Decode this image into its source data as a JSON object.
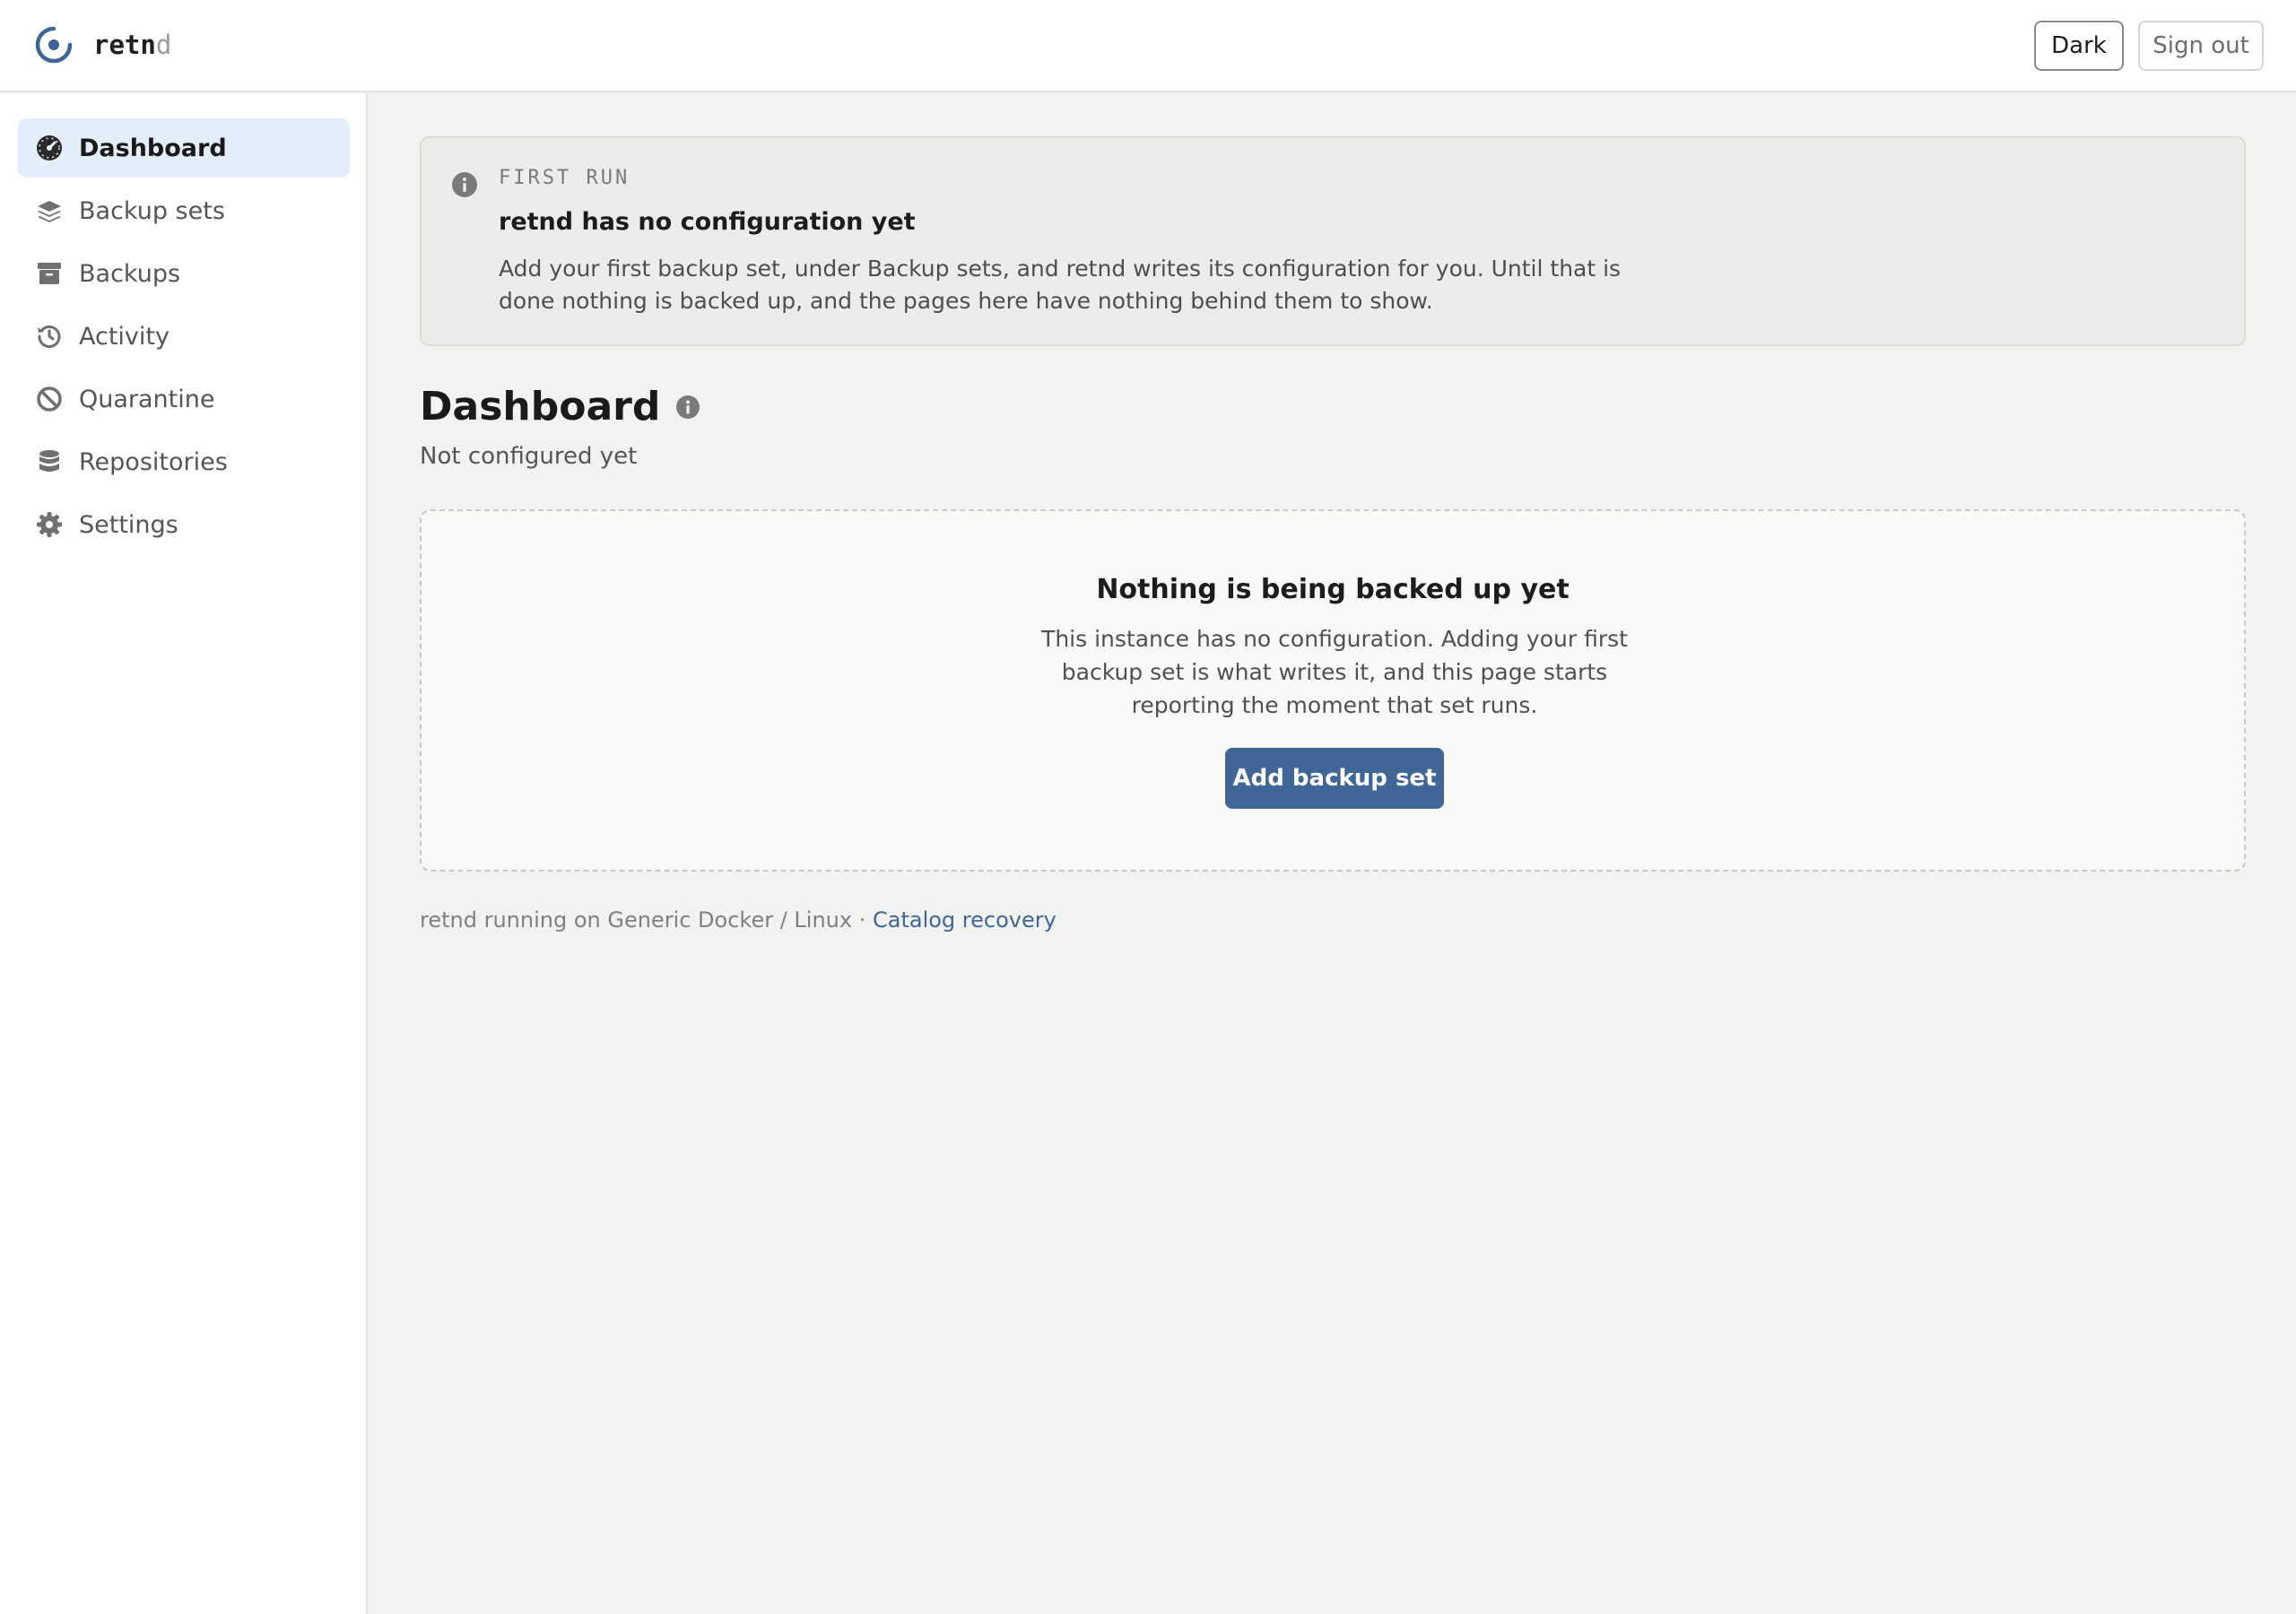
{
  "brand": {
    "name_main": "retn",
    "name_dim": "d"
  },
  "topbar": {
    "theme_button": "Dark",
    "signout_button": "Sign out"
  },
  "sidebar": {
    "items": [
      {
        "label": "Dashboard",
        "icon": "gauge-icon",
        "active": true
      },
      {
        "label": "Backup sets",
        "icon": "layers-icon",
        "active": false
      },
      {
        "label": "Backups",
        "icon": "archive-icon",
        "active": false
      },
      {
        "label": "Activity",
        "icon": "history-icon",
        "active": false
      },
      {
        "label": "Quarantine",
        "icon": "ban-icon",
        "active": false
      },
      {
        "label": "Repositories",
        "icon": "database-icon",
        "active": false
      },
      {
        "label": "Settings",
        "icon": "gear-icon",
        "active": false
      }
    ]
  },
  "notice": {
    "kicker": "FIRST RUN",
    "title": "retnd has no configuration yet",
    "text": "Add your first backup set, under Backup sets, and retnd writes its configuration for you. Until that is done nothing is backed up, and the pages here have nothing behind them to show."
  },
  "main": {
    "title": "Dashboard",
    "subtitle": "Not configured yet",
    "empty": {
      "title": "Nothing is being backed up yet",
      "text": "This instance has no configuration. Adding your first backup set is what writes it, and this page starts reporting the moment that set runs.",
      "button": "Add backup set"
    }
  },
  "footer": {
    "text": "retnd running on Generic Docker / Linux · ",
    "link": "Catalog recovery"
  },
  "colors": {
    "accent": "#3f6696",
    "active_nav_bg": "#e4eefa",
    "icon_grey": "#707070"
  }
}
